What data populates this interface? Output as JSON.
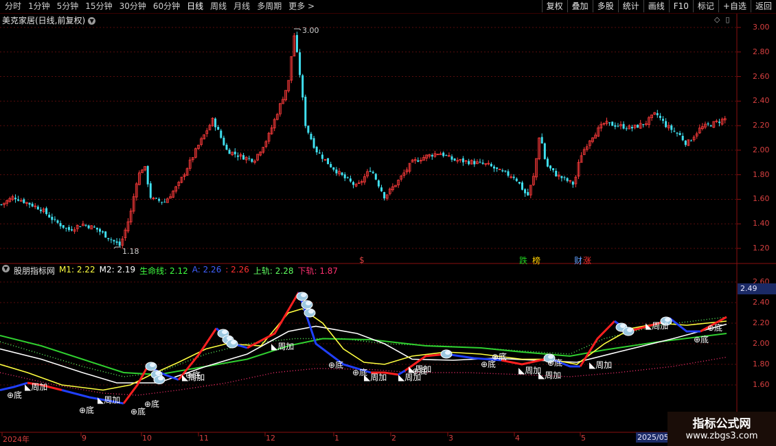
{
  "toolbar": {
    "tabs": [
      "分时",
      "1分钟",
      "5分钟",
      "15分钟",
      "30分钟",
      "60分钟",
      "日线",
      "周线",
      "月线",
      "多周期",
      "更多 >"
    ],
    "active_tab": "日线",
    "right_buttons": [
      "复权",
      "叠加",
      "多股",
      "统计",
      "画线",
      "F10",
      "标记",
      "+自选",
      "返回"
    ]
  },
  "main_chart": {
    "title": "美克家居(日线,前复权)",
    "high_label": "3.00",
    "low_label": "1.18",
    "y_ticks": [
      "3.00",
      "2.80",
      "2.60",
      "2.40",
      "2.20",
      "2.00",
      "1.80",
      "1.60",
      "1.40",
      "1.20"
    ],
    "markers": [
      {
        "text": "$",
        "color": "#ff3030"
      },
      {
        "text": "跌",
        "color": "#20d020"
      },
      {
        "text": "榜",
        "color": "#ffd000"
      },
      {
        "text": "财",
        "color": "#60a0ff"
      },
      {
        "text": "涨",
        "color": "#ff3030"
      }
    ]
  },
  "indicator": {
    "name": "股朋指标网",
    "values": [
      {
        "label": "M1: 2.22",
        "color": "#ffff40"
      },
      {
        "label": "M2: 2.19",
        "color": "#ffffff"
      },
      {
        "label": "生命线: 2.12",
        "color": "#40ff40"
      },
      {
        "label": "A: 2.26",
        "color": "#4060ff"
      },
      {
        "label": ": 2.26",
        "color": "#ff3030"
      },
      {
        "label": "上轨: 2.28",
        "color": "#60ff60"
      },
      {
        "label": "下轨: 1.87",
        "color": "#ff3070"
      }
    ],
    "y_ticks": [
      "2.60",
      "2.40",
      "2.20",
      "2.00",
      "1.80",
      "1.60"
    ],
    "current_value": "2.49",
    "labels": [
      "周加",
      "底",
      "周加",
      "底",
      "底",
      "底",
      "周加",
      "周加",
      "底",
      "底",
      "周加",
      "底",
      "底",
      "周加",
      "周加",
      "底",
      "底",
      "周加",
      "周加",
      "底",
      "底",
      "周加",
      "周加",
      "底"
    ]
  },
  "dates": {
    "labels": [
      "2024年",
      "9",
      "10",
      "11",
      "12",
      "1",
      "2",
      "3",
      "4",
      "5"
    ],
    "current": "2025/05"
  },
  "watermark": {
    "title": "指标公式网",
    "url": "www.zbgs3.com"
  }
}
